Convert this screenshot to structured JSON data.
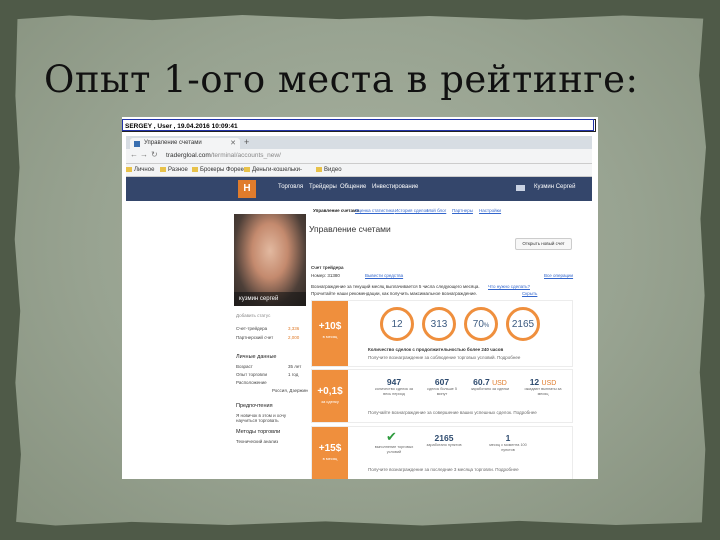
{
  "slide": {
    "title": "Опыт 1-ого места в рейтинге:"
  },
  "screenshot": {
    "userbar": "SERGEY  ,  User  ,  19.04.2016 10:09:41",
    "browser": {
      "tab_title": "Управление счетами",
      "url_domain": "tradergloal.com",
      "url_path": "/terminal/accounts_new/",
      "bookmarks": [
        "Личное",
        "Разное",
        "Брокеры Форекс",
        "Деньги-кошельки-",
        "Видео"
      ]
    },
    "site_nav": {
      "items": [
        "Торговля",
        "Трейдеры",
        "Общение",
        "Инвестирование"
      ],
      "user_name": "Кузмин Сергей"
    },
    "profile": {
      "name": "кузмин сергей",
      "status": "Добавить статус",
      "rows": [
        {
          "label": "Счет-трейдера",
          "value": "3,336"
        },
        {
          "label": "Партнерский счет",
          "value": "2,000"
        }
      ],
      "personal_header": "Личные данные",
      "personal_rows": [
        {
          "label": "Возраст",
          "value": "35 лет"
        },
        {
          "label": "Опыт торговли",
          "value": "1 год"
        },
        {
          "label": "Расположение",
          "value": "Россия, Дзержинск"
        }
      ],
      "prefs_header": "Предпочтения",
      "prefs_text": "Я новичок в этом и хочу научиться торговать",
      "methods_header": "Методы торговли",
      "methods_text": "Технический анализ"
    },
    "main": {
      "subtabs": [
        "Управление счетами",
        "Оценка статистика",
        "История сделок",
        "Мой блог",
        "Партнеры",
        "Настройки"
      ],
      "header": "Управление счетами",
      "open_button": "Открыть новый счет",
      "account_label": "Счет трейдера",
      "account_number": "Номер: 31380",
      "withdraw_link": "Вывести средства",
      "all_trades_link": "Все операции",
      "reward_text": "Вознаграждение за текущий месяц выплачивается 5 числа следующего месяца.",
      "reward_link": "Что нужно сделать?",
      "reward_text2": "Прочитайте наши рекомендации, как получить максимальное вознаграждение.",
      "hide_link": "Скрыть",
      "card1": {
        "bonus": "+10$",
        "bonus_note": "в месяц",
        "circles": [
          "12",
          "313",
          "70",
          "2165"
        ],
        "pct": "%",
        "caption": "Количество сделок с продолжительностью более 240 часов",
        "note": "Получите вознаграждение за соблюдение торговых условий. Подробнее"
      },
      "card2": {
        "bonus": "+0,1$",
        "bonus_note": "за сделку",
        "stats": [
          {
            "n": "947",
            "usd": "",
            "l": "количество сделок за весь период"
          },
          {
            "n": "607",
            "usd": "",
            "l": "сделок больше 5 минут"
          },
          {
            "n": "60.7",
            "usd": "USD",
            "l": "заработано за сделки"
          },
          {
            "n": "12",
            "usd": "USD",
            "l": "ожидают выплаты за месяц"
          }
        ],
        "note": "Получайте вознаграждение за совершение ваших успешных сделок. Подробнее"
      },
      "card3": {
        "bonus": "+15$",
        "bonus_note": "в месяц",
        "stats": [
          {
            "n": "2165",
            "l": "заработано пунктов"
          },
          {
            "n": "1",
            "l": "месяц с момента 100 пунктов"
          }
        ],
        "check_label": "выполнение торговых условий",
        "note": "Получите вознаграждение за последние 3 месяца торговли. Подробнее"
      }
    }
  }
}
